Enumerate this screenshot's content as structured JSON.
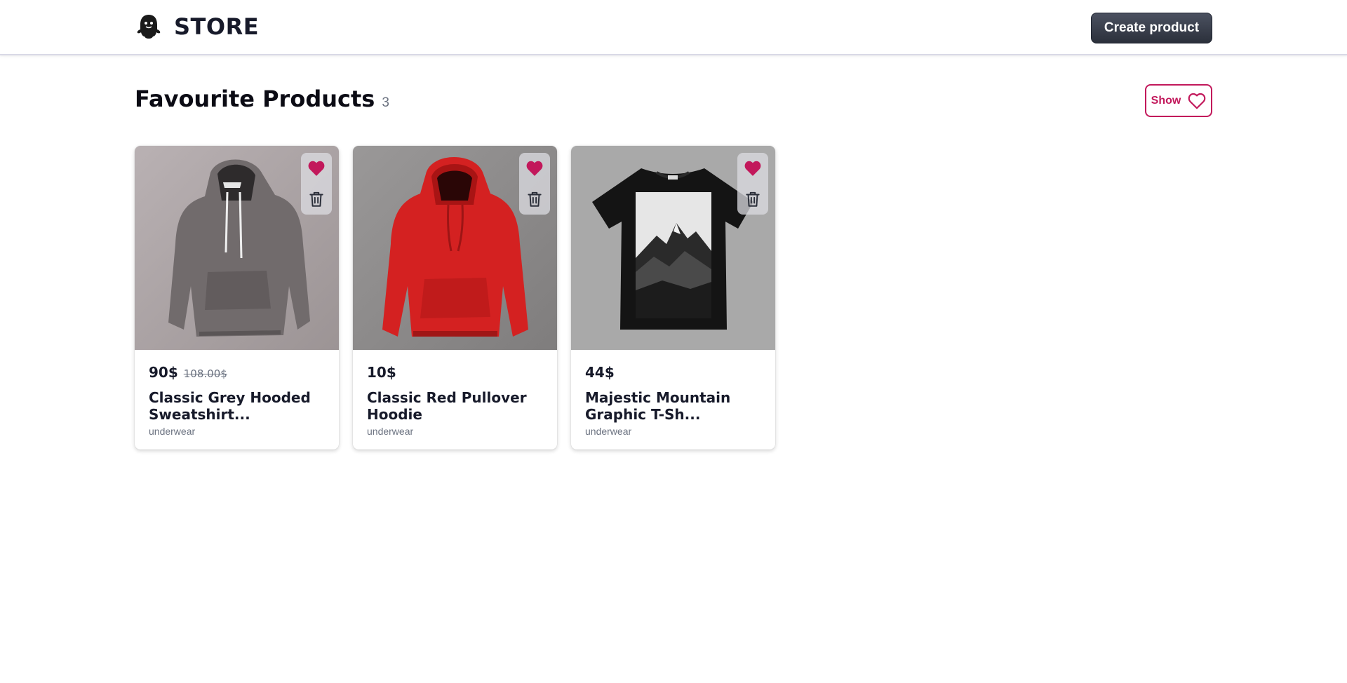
{
  "header": {
    "brand_name": "STORE",
    "create_label": "Create product"
  },
  "section": {
    "title": "Favourite Products",
    "count": "3",
    "show_label": "Show"
  },
  "products": [
    {
      "price": "90$",
      "old_price": "108.00$",
      "title": "Classic Grey Hooded Sweatshirt...",
      "category": "underwear",
      "favourite": true,
      "image": "grey-hoodie"
    },
    {
      "price": "10$",
      "old_price": "",
      "title": "Classic Red Pullover Hoodie",
      "category": "underwear",
      "favourite": true,
      "image": "red-hoodie"
    },
    {
      "price": "44$",
      "old_price": "",
      "title": "Majestic Mountain Graphic T-Sh...",
      "category": "underwear",
      "favourite": true,
      "image": "mountain-tshirt"
    }
  ],
  "colors": {
    "accent": "#c2185b",
    "primary_button": "#2b303b",
    "text": "#171a2a",
    "muted": "#6b7280"
  }
}
